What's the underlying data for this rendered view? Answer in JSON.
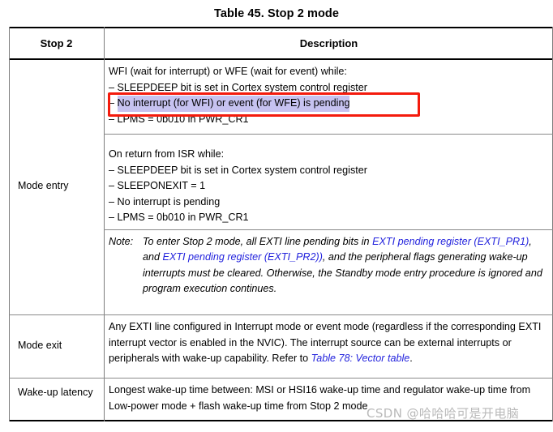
{
  "title": "Table 45. Stop 2 mode",
  "header": {
    "col_label": "Stop 2",
    "col_description": "Description"
  },
  "rows": {
    "mode_entry": {
      "label": "Mode entry",
      "block1": {
        "intro": "WFI (wait for interrupt) or WFE (wait for event) while:",
        "item1": "– SLEEPDEEP bit is set in Cortex system control register",
        "item2_dash": "–",
        "item2_highlighted": "No interrupt (for WFI) or event (for WFE) is pending",
        "item3": "– LPMS = 0b010 in PWR_CR1"
      },
      "block2": {
        "intro": "On return from ISR while:",
        "item1": "– SLEEPDEEP bit is set in Cortex system control register",
        "item2": "– SLEEPONEXIT = 1",
        "item3": "– No interrupt is pending",
        "item4": "– LPMS = 0b010 in PWR_CR1"
      },
      "note": {
        "label": "Note:",
        "part1": "To enter Stop 2 mode, all EXTI line pending bits in ",
        "link1": "EXTI pending register (EXTI_PR1)",
        "part2": ", and ",
        "link2": "EXTI pending register (EXTI_PR2))",
        "part3": ", and the peripheral flags generating wake-up interrupts must be cleared. Otherwise, the Standby mode entry procedure is ignored and program execution continues."
      }
    },
    "mode_exit": {
      "label": "Mode exit",
      "text_part1": "Any EXTI line configured in Interrupt mode or event mode (regardless if the corresponding EXTI interrupt vector is enabled in the NVIC). The interrupt source can be external interrupts or peripherals with wake-up capability. Refer to ",
      "link": "Table 78: Vector table",
      "text_part2": "."
    },
    "wakeup_latency": {
      "label": "Wake-up latency",
      "text": "Longest wake-up time between: MSI or HSI16 wake-up time and regulator wake-up time from Low-power mode + flash wake-up time from Stop 2 mode"
    }
  },
  "annotations": {
    "highlight_color": "#c6c2f0",
    "box_color": "#f41b0d",
    "link_color": "#2323dd"
  },
  "watermark": "CSDN @哈哈哈可是开电脑"
}
